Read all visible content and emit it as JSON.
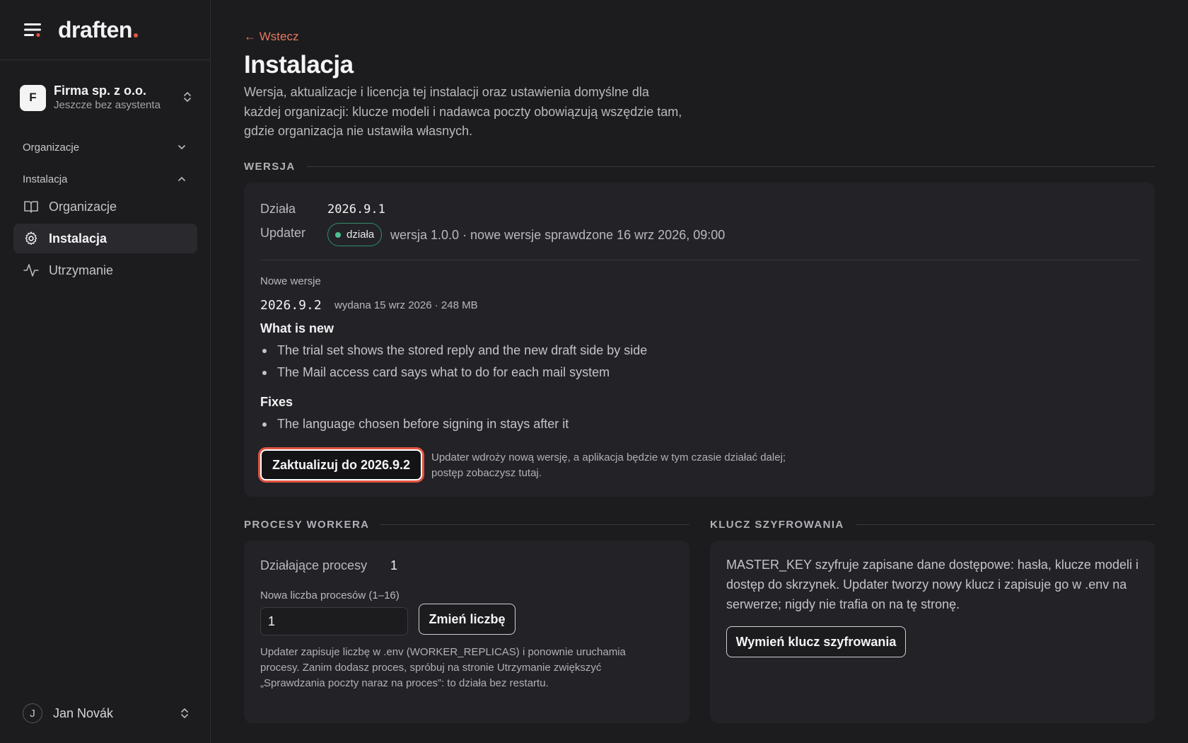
{
  "brand": {
    "name": "draften",
    "accent": "#e2553f"
  },
  "org_switcher": {
    "avatar_letter": "F",
    "name": "Firma sp. z o.o.",
    "subtitle": "Jeszcze bez asystenta"
  },
  "sidebar": {
    "groups": [
      {
        "label": "Organizacje",
        "expanded": false
      },
      {
        "label": "Instalacja",
        "expanded": true
      }
    ],
    "items": [
      {
        "label": "Organizacje",
        "icon": "book-open-icon",
        "active": false
      },
      {
        "label": "Instalacja",
        "icon": "gear-icon",
        "active": true
      },
      {
        "label": "Utrzymanie",
        "icon": "activity-icon",
        "active": false
      }
    ]
  },
  "user": {
    "avatar_letter": "J",
    "name": "Jan Novák"
  },
  "page": {
    "back_label": "← Wstecz",
    "title": "Instalacja",
    "description": "Wersja, aktualizacje i licencja tej instalacji oraz ustawienia domyślne dla każdej organizacji: klucze modeli i nadawca poczty obowiązują wszędzie tam, gdzie organizacja nie ustawiła własnych."
  },
  "version": {
    "section_title": "WERSJA",
    "running_label": "Działa",
    "running_value": "2026.9.1",
    "updater_label": "Updater",
    "updater_status": "działa",
    "updater_status_color": "#4cc08f",
    "updater_info": "wersja 1.0.0 · nowe wersje sprawdzone 16 wrz 2026, 09:00",
    "new_versions_label": "Nowe wersje",
    "new_version": "2026.9.2",
    "new_version_meta": "wydana 15 wrz 2026 · 248 MB",
    "whats_new_title": "What is new",
    "whats_new": [
      "The trial set shows the stored reply and the new draft side by side",
      "The Mail access card says what to do for each mail system"
    ],
    "fixes_title": "Fixes",
    "fixes": [
      "The language chosen before signing in stays after it"
    ],
    "update_button": "Zaktualizuj do 2026.9.2",
    "update_hint": "Updater wdroży nową wersję, a aplikacja będzie w tym czasie działać dalej; postęp zobaczysz tutaj."
  },
  "workers": {
    "section_title": "PROCESY WORKERA",
    "running_label": "Działające procesy",
    "running_value": "1",
    "new_count_label": "Nowa liczba procesów (1–16)",
    "new_count_value": "1",
    "change_button": "Zmień liczbę",
    "hint": "Updater zapisuje liczbę w .env (WORKER_REPLICAS) i ponownie uruchamia procesy. Zanim dodasz proces, spróbuj na stronie Utrzymanie zwiększyć „Sprawdzania poczty naraz na proces”: to działa bez restartu."
  },
  "encryption": {
    "section_title": "KLUCZ SZYFROWANIA",
    "description": "MASTER_KEY szyfruje zapisane dane dostępowe: hasła, klucze modeli i dostęp do skrzynek. Updater tworzy nowy klucz i zapisuje go w .env na serwerze; nigdy nie trafia on na tę stronę.",
    "button": "Wymień klucz szyfrowania"
  }
}
